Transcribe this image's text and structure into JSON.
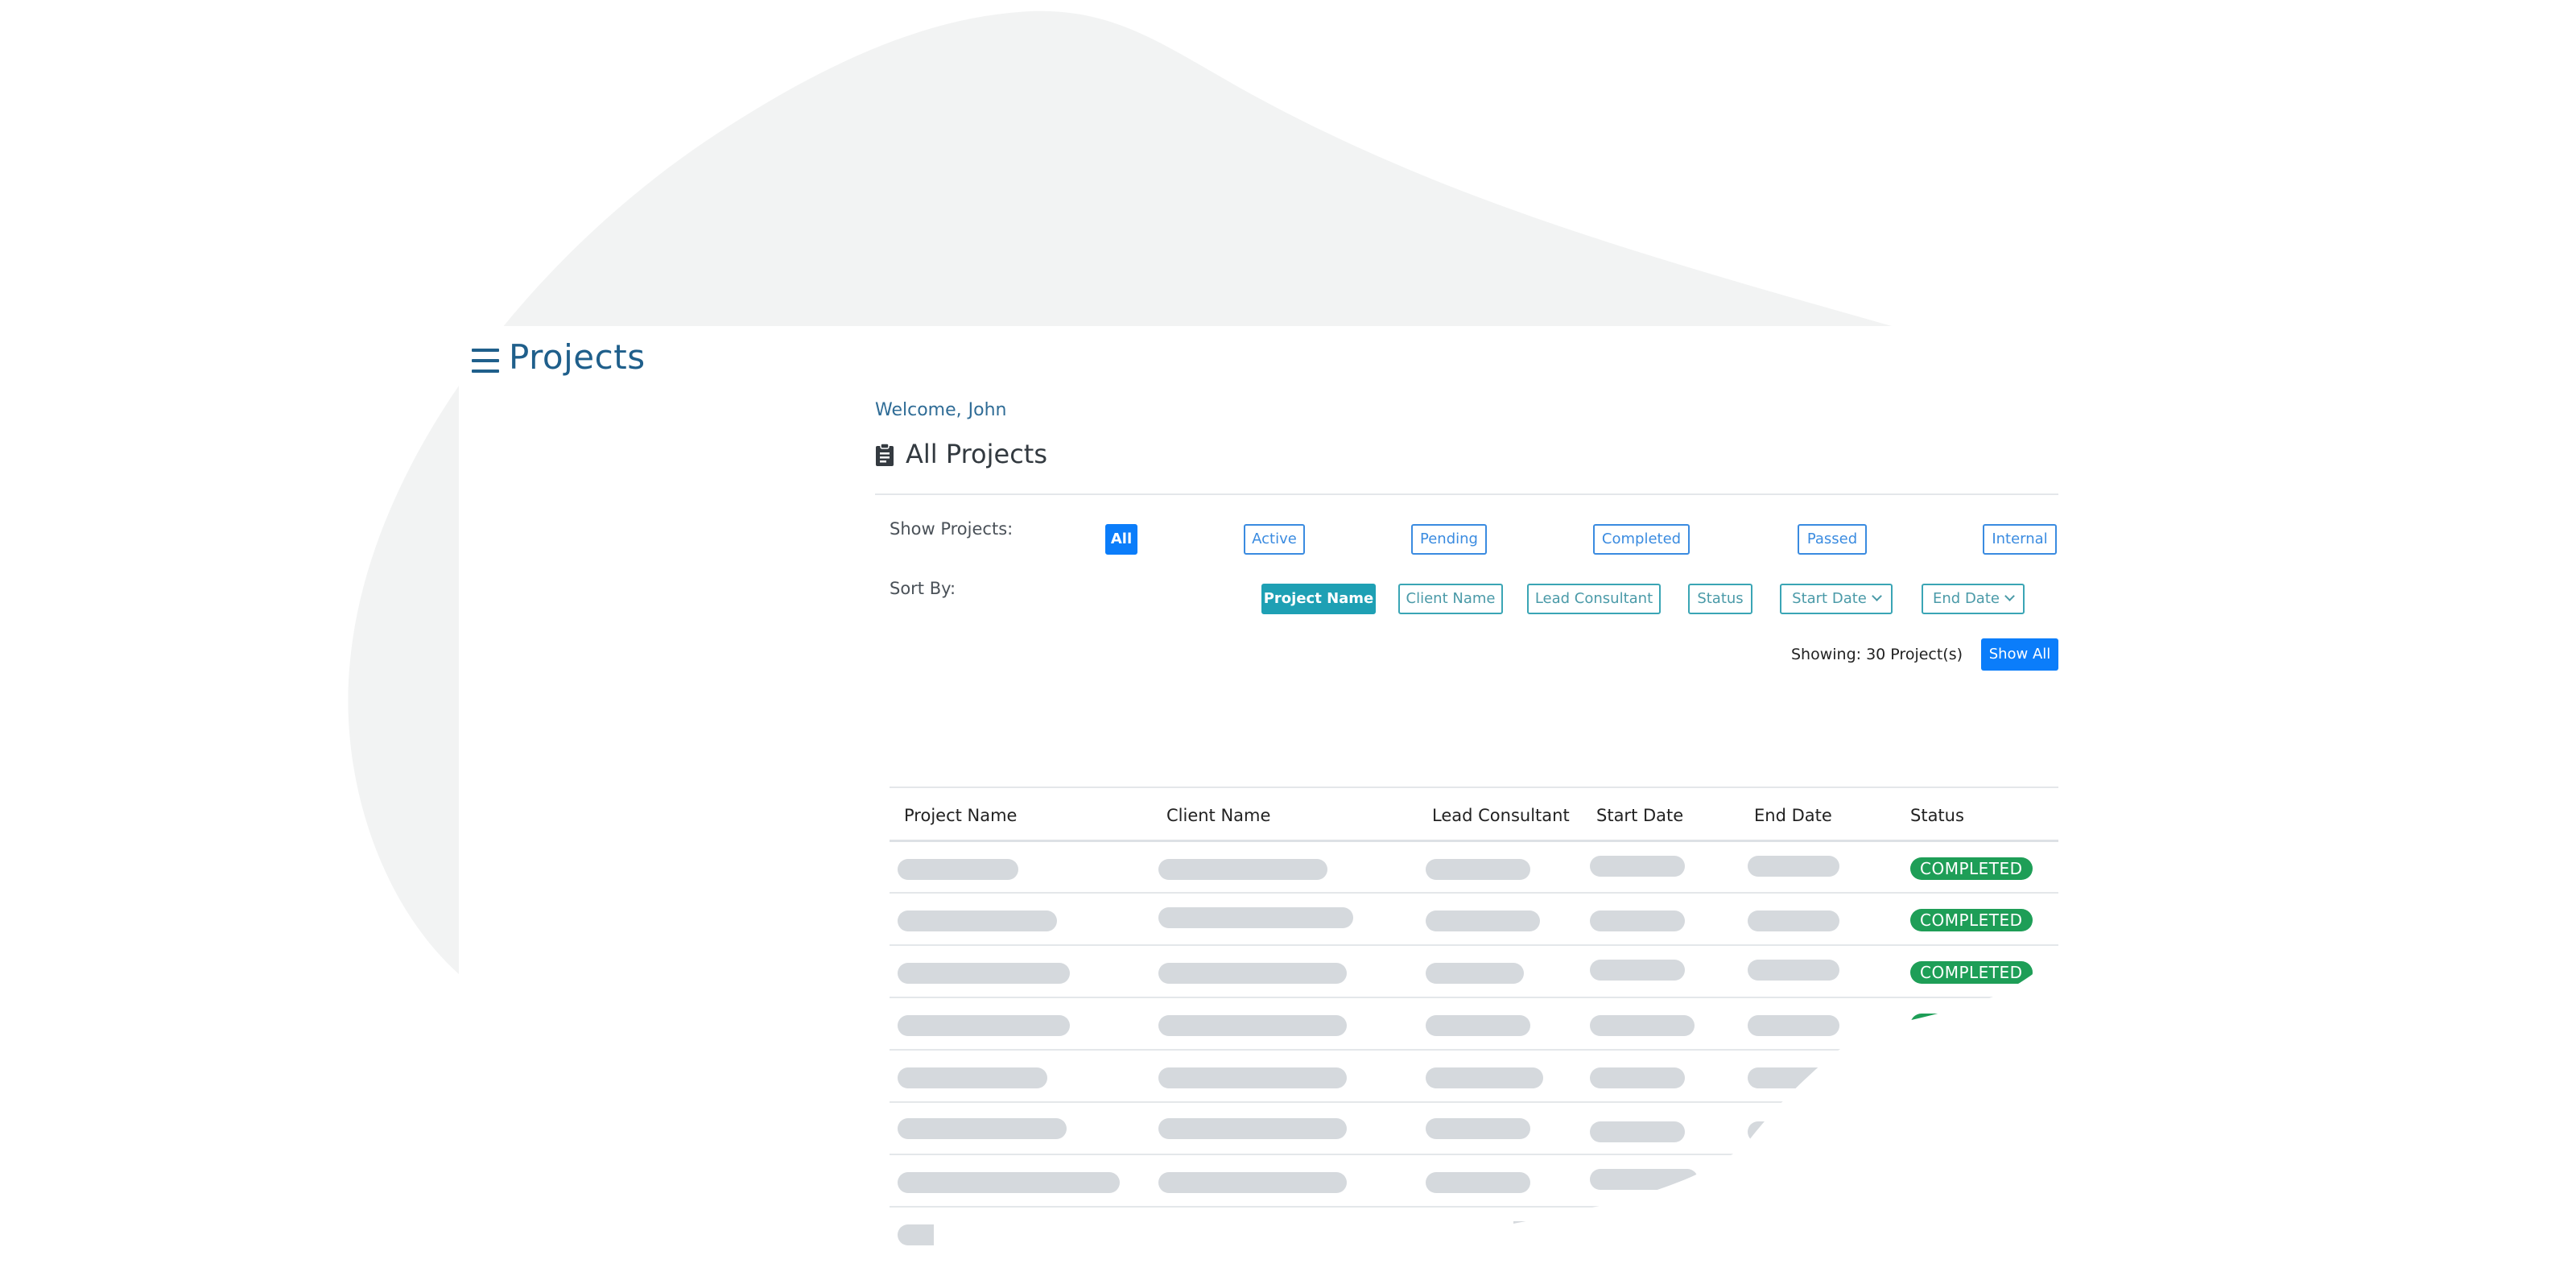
{
  "header": {
    "title": "Projects",
    "menu_icon": "hamburger-menu-icon"
  },
  "welcome": {
    "prefix": "Welcome,",
    "user": "John"
  },
  "page": {
    "title": "All Projects",
    "icon": "clipboard-icon"
  },
  "filters": {
    "label": "Show Projects:",
    "options": [
      "All",
      "Active",
      "Pending",
      "Completed",
      "Passed",
      "Internal"
    ],
    "selected": "All"
  },
  "sort": {
    "label": "Sort By:",
    "options": [
      "Project Name",
      "Client Name",
      "Lead Consultant",
      "Status",
      "Start Date",
      "End Date"
    ],
    "selected": "Project Name"
  },
  "summary": {
    "showing": "Showing: 30 Project(s)",
    "show_all": "Show All"
  },
  "table": {
    "columns": [
      "Project Name",
      "Client Name",
      "Lead Consultant",
      "Start Date",
      "End Date",
      "Status"
    ],
    "status_text": "COMPLETED"
  },
  "colors": {
    "brand_blue": "#0b7dfa",
    "teal": "#1ea0b4",
    "title_blue": "#1f5f8b",
    "status_green": "#1e9e57",
    "skeleton": "#d5d9dd",
    "blob": "#f2f3f3"
  }
}
